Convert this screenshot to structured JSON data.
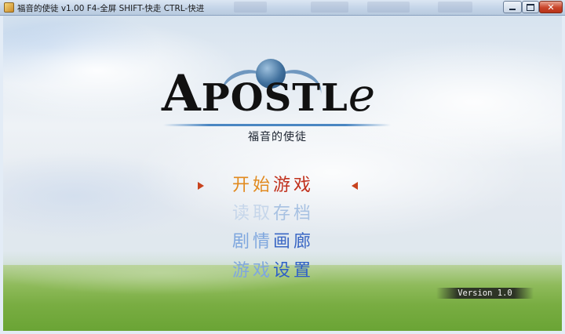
{
  "window": {
    "title": "福音的使徒 v1.00 F4-全屏 SHIFT-快走 CTRL-快进",
    "controls": [
      "minimize",
      "maximize",
      "close"
    ],
    "close_glyph": "✕"
  },
  "logo": {
    "word_parts": [
      "A",
      "POSTL",
      "e"
    ],
    "subtitle": "福音的使徒"
  },
  "menu": {
    "items": [
      {
        "a": "开始",
        "b": "游戏",
        "selected": true
      },
      {
        "a": "读取",
        "b": "存档",
        "selected": false
      },
      {
        "a": "剧情",
        "b": "画廊",
        "selected": false
      },
      {
        "a": "游戏",
        "b": "设置",
        "selected": false
      }
    ]
  },
  "version": "Version 1.0",
  "colors": {
    "selected_a": "#e18a1f",
    "selected_b": "#c1311d",
    "disabled": "#a7c1e2",
    "normal": "#2d5fc8",
    "cursor": "#c8431e"
  },
  "icons": {
    "app": "app-icon",
    "cursor_left": "triangle-right-icon",
    "cursor_right": "triangle-left-icon"
  }
}
